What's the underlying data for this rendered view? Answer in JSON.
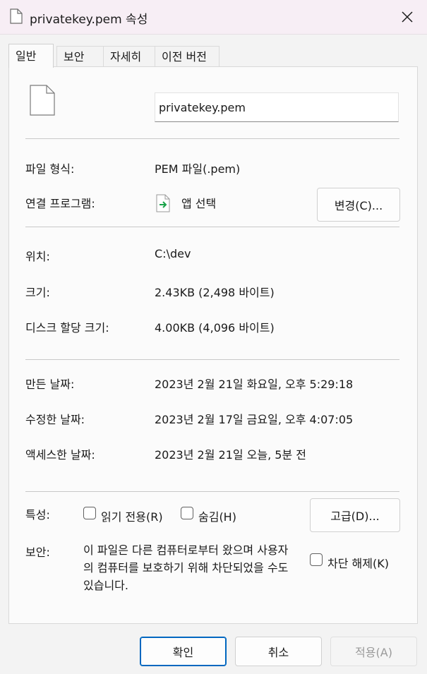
{
  "window": {
    "title": "privatekey.pem 속성",
    "close_icon": "close-icon"
  },
  "tabs": [
    {
      "label": "일반",
      "active": true
    },
    {
      "label": "보안",
      "active": false
    },
    {
      "label": "자세히",
      "active": false
    },
    {
      "label": "이전 버전",
      "active": false
    }
  ],
  "general": {
    "file_name": "privatekey.pem",
    "file_type_label": "파일 형식:",
    "file_type_value": "PEM 파일(.pem)",
    "opens_with_label": "연결 프로그램:",
    "opens_with_value": "앱 선택",
    "change_button": "변경(C)...",
    "location_label": "위치:",
    "location_value": "C:\\dev",
    "size_label": "크기:",
    "size_value": "2.43KB (2,498 바이트)",
    "disk_size_label": "디스크 할당 크기:",
    "disk_size_value": "4.00KB (4,096 바이트)",
    "created_label": "만든 날짜:",
    "created_value": "2023년 2월 21일 화요일, 오후 5:29:18",
    "modified_label": "수정한 날짜:",
    "modified_value": "2023년 2월 17일 금요일, 오후 4:07:05",
    "accessed_label": "액세스한 날짜:",
    "accessed_value": "2023년 2월 21일 오늘, 5분 전",
    "attributes_label": "특성:",
    "readonly_label": "읽기 전용(R)",
    "hidden_label": "숨김(H)",
    "advanced_button": "고급(D)...",
    "security_label": "보안:",
    "security_text": "이 파일은 다른 컴퓨터로부터 왔으며 사용자의 컴퓨터를 보호하기 위해 차단되었을 수도 있습니다.",
    "unblock_label": "차단 해제(K)"
  },
  "footer": {
    "ok": "확인",
    "cancel": "취소",
    "apply": "적용(A)"
  },
  "colors": {
    "accent": "#0067c0",
    "titlebar": "#f7eef5",
    "arrow_green": "#1aa34a"
  }
}
